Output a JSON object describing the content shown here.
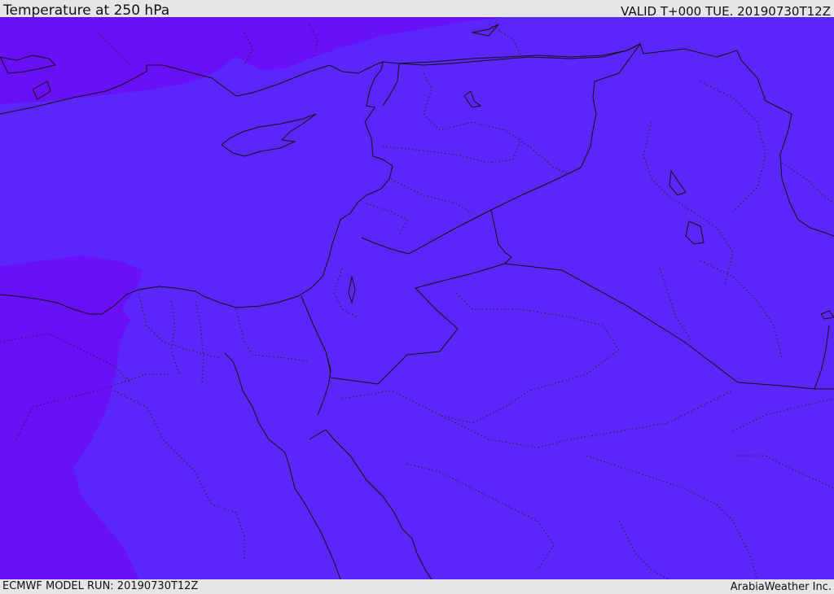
{
  "header": {
    "title": "Temperature at 250 hPa",
    "valid": "VALID T+000 TUE. 20190730T12Z"
  },
  "footer": {
    "model_run": "ECMWF MODEL RUN: 20190730T12Z",
    "credit": "ArabiaWeather Inc."
  },
  "colors": {
    "band_base": "#5a26fa",
    "band_warm": "#6a10f8",
    "frame": "#e6e6e6",
    "lines": "#111111"
  }
}
